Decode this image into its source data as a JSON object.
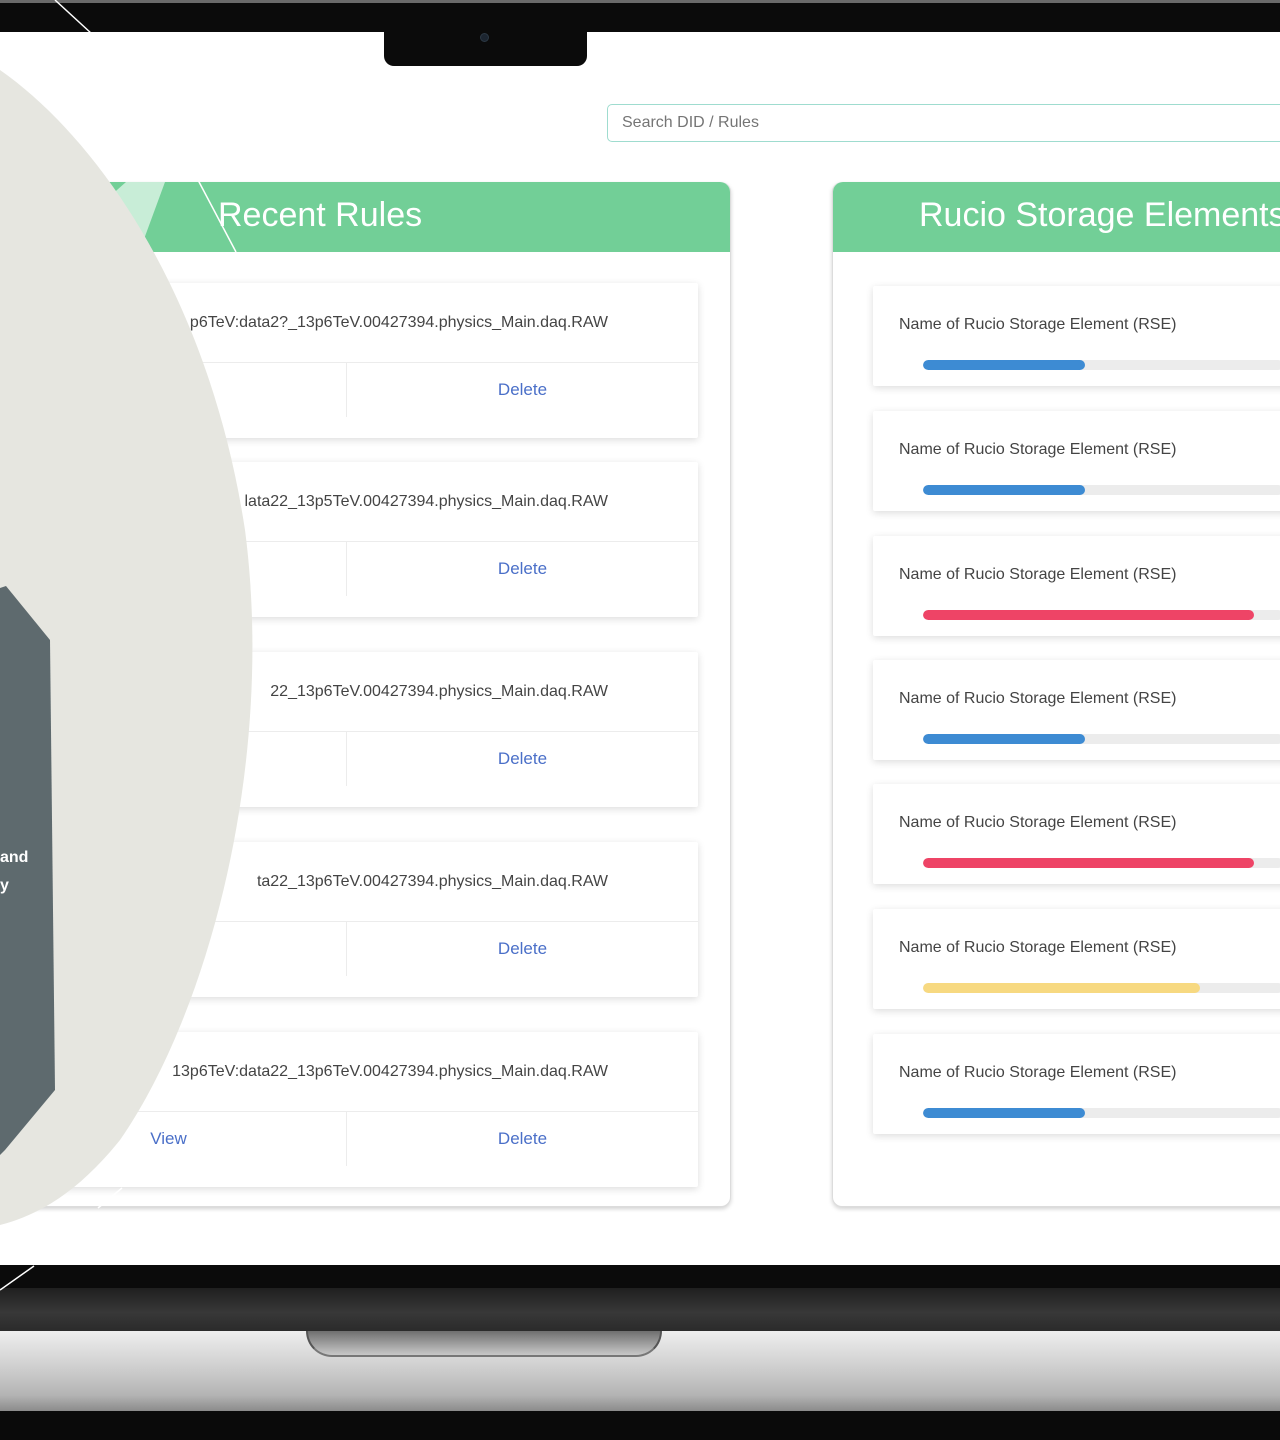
{
  "search": {
    "placeholder": "Search DID / Rules"
  },
  "recent_rules": {
    "title": "Recent Rules",
    "items": [
      {
        "name": "p6TeV:data2?_13p6TeV.00427394.physics_Main.daq.RAW",
        "view": "",
        "delete": "Delete"
      },
      {
        "name": "lata22_13p5TeV.00427394.physics_Main.daq.RAW",
        "view": "",
        "delete": "Delete"
      },
      {
        "name": "22_13p6TeV.00427394.physics_Main.daq.RAW",
        "view": "",
        "delete": "Delete"
      },
      {
        "name": "ta22_13p6TeV.00427394.physics_Main.daq.RAW",
        "view": "",
        "delete": "Delete"
      },
      {
        "name": "13p6TeV:data22_13p6TeV.00427394.physics_Main.daq.RAW",
        "view": "View",
        "delete": "Delete"
      }
    ]
  },
  "rse": {
    "title": "Rucio Storage Elements",
    "items": [
      {
        "name": "Name of Rucio Storage Element (RSE)",
        "usage": 0.45,
        "color": "#3d8bd3"
      },
      {
        "name": "Name of Rucio Storage Element (RSE)",
        "usage": 0.45,
        "color": "#3d8bd3"
      },
      {
        "name": "Name of Rucio Storage Element (RSE)",
        "usage": 0.92,
        "color": "#ee4466"
      },
      {
        "name": "Name of Rucio Storage Element (RSE)",
        "usage": 0.45,
        "color": "#3d8bd3"
      },
      {
        "name": "Name of Rucio Storage Element (RSE)",
        "usage": 0.92,
        "color": "#ee4466"
      },
      {
        "name": "Name of Rucio Storage Element (RSE)",
        "usage": 0.77,
        "color": "#f7d981"
      },
      {
        "name": "Name of Rucio Storage Element (RSE)",
        "usage": 0.45,
        "color": "#3d8bd3"
      }
    ]
  },
  "side_text": {
    "line1": "and",
    "line2": "y"
  },
  "colors": {
    "header": "#72cf97",
    "link": "#4a6fc8",
    "blob": "#e6e6e0",
    "hexagon": "#5e6a6e"
  }
}
